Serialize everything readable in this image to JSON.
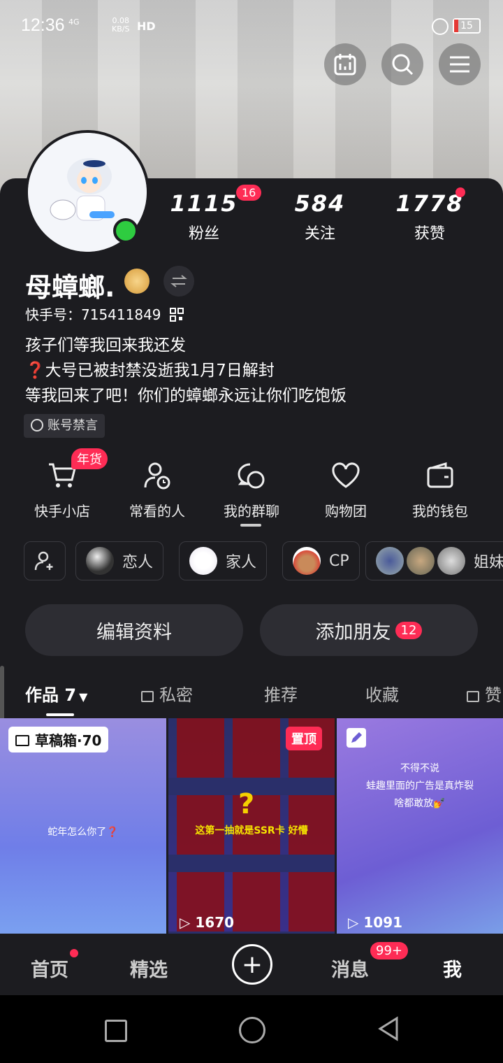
{
  "status": {
    "time": "12:36",
    "network": "4G",
    "speed_top": "0.08",
    "speed_bottom": "KB/S",
    "hd": "HD",
    "battery": "15"
  },
  "profile": {
    "stats": [
      {
        "value": "1115",
        "label": "粉丝",
        "badge": "16"
      },
      {
        "value": "584",
        "label": "关注"
      },
      {
        "value": "1778",
        "label": "获赞"
      }
    ],
    "name": "母蟑螂.",
    "account_id": "快手号：715411849",
    "bio_lines": [
      "孩子们等我回来我还发",
      "❓大号已被封禁没逝我1月7日解封",
      "等我回来了吧！你们的蟑螂永远让你们吃饱饭"
    ],
    "muted_tag": "账号禁言"
  },
  "services": [
    {
      "label": "快手小店",
      "badge": "年货",
      "icon": "cart-icon"
    },
    {
      "label": "常看的人",
      "icon": "person-clock-icon"
    },
    {
      "label": "我的群聊",
      "icon": "chat-icon"
    },
    {
      "label": "购物团",
      "icon": "heart-icon"
    },
    {
      "label": "我的钱包",
      "icon": "wallet-icon"
    }
  ],
  "relations": [
    {
      "label": "恋人"
    },
    {
      "label": "家人"
    },
    {
      "label": "CP"
    },
    {
      "label": "姐妹"
    }
  ],
  "actions": {
    "edit": "编辑资料",
    "add_friend": "添加朋友",
    "add_friend_badge": "12"
  },
  "tabs": [
    "作品 7",
    "私密",
    "推荐",
    "收藏",
    "赞"
  ],
  "tiles": {
    "draft": "草稿箱·70",
    "t1_caption": "蛇年怎么你了❓",
    "pinned": "置顶",
    "t2_caption": "这第一抽就是SSR卡 好懵",
    "t2_views": "1670",
    "t3_caption_lines": [
      "不得不说",
      "蛙趣里面的广告是真炸裂",
      "啥都敢放💅"
    ],
    "t3_views": "1091"
  },
  "nav": {
    "home": "首页",
    "featured": "精选",
    "messages": "消息",
    "messages_badge": "99+",
    "me": "我"
  }
}
